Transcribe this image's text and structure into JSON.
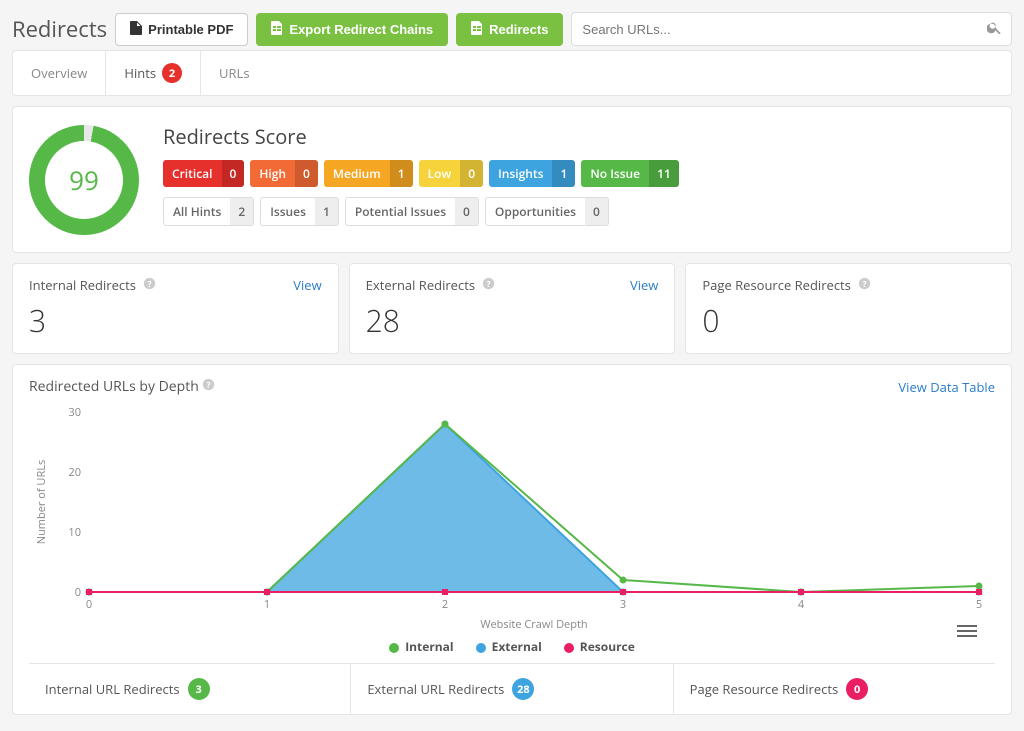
{
  "page": {
    "title": "Redirects"
  },
  "header": {
    "printable": "Printable PDF",
    "export": "Export Redirect Chains",
    "redirects": "Redirects",
    "search_placeholder": "Search URLs..."
  },
  "tabs": {
    "overview": "Overview",
    "hints": "Hints",
    "hints_count": "2",
    "urls": "URLs"
  },
  "score": {
    "title": "Redirects Score",
    "value": "99",
    "severity": [
      {
        "label": "Critical",
        "count": "0"
      },
      {
        "label": "High",
        "count": "0"
      },
      {
        "label": "Medium",
        "count": "1"
      },
      {
        "label": "Low",
        "count": "0"
      },
      {
        "label": "Insights",
        "count": "1"
      },
      {
        "label": "No Issue",
        "count": "11"
      }
    ],
    "filters": [
      {
        "label": "All Hints",
        "count": "2"
      },
      {
        "label": "Issues",
        "count": "1"
      },
      {
        "label": "Potential Issues",
        "count": "0"
      },
      {
        "label": "Opportunities",
        "count": "0"
      }
    ]
  },
  "stats": {
    "view": "View",
    "items": [
      {
        "label": "Internal Redirects",
        "value": "3",
        "has_view": true
      },
      {
        "label": "External Redirects",
        "value": "28",
        "has_view": true
      },
      {
        "label": "Page Resource Redirects",
        "value": "0",
        "has_view": false
      }
    ]
  },
  "chart": {
    "title": "Redirected URLs by Depth",
    "view_table": "View Data Table",
    "xlabel": "Website Crawl Depth",
    "ylabel": "Number of URLs",
    "legend": {
      "internal": "Internal",
      "external": "External",
      "resource": "Resource"
    },
    "colors": {
      "internal": "#55b847",
      "external": "#3ea4e0",
      "resource": "#e91e63"
    }
  },
  "chart_data": {
    "type": "area",
    "title": "Redirected URLs by Depth",
    "xlabel": "Website Crawl Depth",
    "ylabel": "Number of URLs",
    "categories": [
      "0",
      "1",
      "2",
      "3",
      "4",
      "5"
    ],
    "ylim": [
      0,
      30
    ],
    "series": [
      {
        "name": "Internal",
        "values": [
          0,
          0,
          28,
          2,
          0,
          1
        ]
      },
      {
        "name": "External",
        "values": [
          0,
          0,
          28,
          0,
          0,
          0
        ]
      },
      {
        "name": "Resource",
        "values": [
          0,
          0,
          0,
          0,
          0,
          0
        ]
      }
    ]
  },
  "footer": {
    "items": [
      {
        "label": "Internal URL Redirects",
        "count": "3",
        "color": "green"
      },
      {
        "label": "External URL Redirects",
        "count": "28",
        "color": "blue"
      },
      {
        "label": "Page Resource Redirects",
        "count": "0",
        "color": "pink"
      }
    ]
  }
}
